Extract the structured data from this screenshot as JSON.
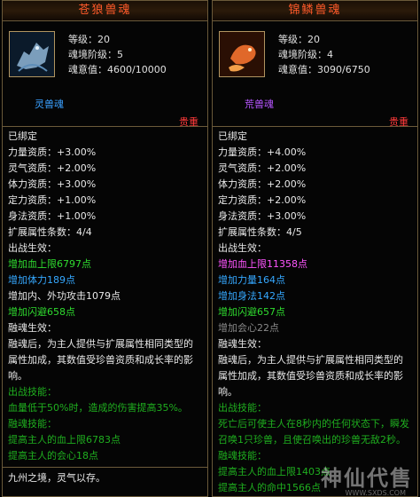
{
  "left": {
    "title": "苍狼兽魂",
    "level": "等级：20",
    "stage": "魂境阶级：5",
    "soul": "魂意值：4600/10000",
    "type": "灵兽魂",
    "rarity": "贵重",
    "bound": "已绑定",
    "attrs": [
      "力量资质：+3.00%",
      "灵气资质：+2.00%",
      "体力资质：+3.00%",
      "定力资质：+1.00%",
      "身法资质：+1.00%"
    ],
    "ext_count": "扩展属性条数：4/4",
    "battle": "出战生效：",
    "effects": [
      {
        "text": "增加血上限6797点",
        "c": "g"
      },
      {
        "text": "增加体力189点",
        "c": "b"
      },
      {
        "text": "增加内、外功攻击1079点",
        "c": "w"
      },
      {
        "text": "增加闪避658点",
        "c": "g"
      }
    ],
    "fuse_label": "融魂生效：",
    "fuse_desc": "融魂后，为主人提供与扩展属性相同类型的属性加成，其数值受珍兽资质和成长率的影响。",
    "skill_label": "出战技能：",
    "skills": [
      "血量低于50%时，造成的伤害提高35%。",
      "融魂技能：",
      "提高主人的血上限6783点",
      "提高主人的会心18点"
    ],
    "bottom": "九州之境，灵气以存。"
  },
  "right": {
    "title": "锦鳞兽魂",
    "level": "等级：20",
    "stage": "魂境阶级：4",
    "soul": "魂意值：3090/6750",
    "type": "荒兽魂",
    "rarity": "贵重",
    "bound": "已绑定",
    "attrs": [
      "力量资质：+4.00%",
      "灵气资质：+2.00%",
      "体力资质：+2.00%",
      "定力资质：+2.00%",
      "身法资质：+3.00%"
    ],
    "ext_count": "扩展属性条数：4/5",
    "battle": "出战生效：",
    "effects": [
      {
        "text": "增加血上限11358点",
        "c": "p"
      },
      {
        "text": "增加力量164点",
        "c": "b"
      },
      {
        "text": "增加身法142点",
        "c": "b"
      },
      {
        "text": "增加闪避657点",
        "c": "g"
      },
      {
        "text": "增加会心22点",
        "c": "gr"
      }
    ],
    "fuse_label": "融魂生效：",
    "fuse_desc": "融魂后，为主人提供与扩展属性相同类型的属性加成，其数值受珍兽资质和成长率的影响。",
    "skill_label": "出战技能：",
    "skills": [
      "死亡后可使主人在8秒内的任何状态下，瞬发召唤1只珍兽，且使召唤出的珍兽无敌2秒。",
      "融魂技能：",
      "提高主人的血上限1403点",
      "提高主人的命中1566点"
    ]
  },
  "watermark": {
    "text": "神仙代售",
    "url": "WWW.SXDS.COM"
  }
}
